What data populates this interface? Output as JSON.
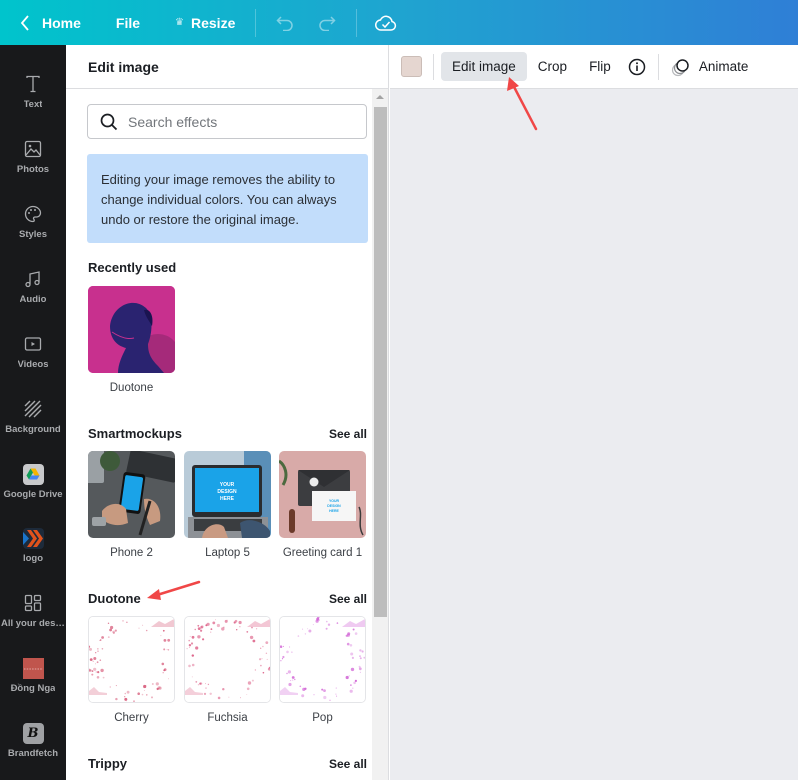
{
  "topbar": {
    "home_label": "Home",
    "file_label": "File",
    "resize_label": "Resize",
    "icons": [
      "chevron-left-icon",
      "crown-icon",
      "undo-icon",
      "redo-icon",
      "cloud-check-icon"
    ]
  },
  "rail": {
    "items": [
      {
        "label": "Text",
        "icon": "text-icon"
      },
      {
        "label": "Photos",
        "icon": "photos-icon"
      },
      {
        "label": "Styles",
        "icon": "palette-icon"
      },
      {
        "label": "Audio",
        "icon": "music-note-icon"
      },
      {
        "label": "Videos",
        "icon": "video-icon"
      },
      {
        "label": "Background",
        "icon": "background-hatch-icon"
      },
      {
        "label": "Google Drive",
        "icon": "google-drive-icon"
      },
      {
        "label": "logo",
        "icon": "logo-chevrons-icon"
      },
      {
        "label": "All your desi...",
        "icon": "grid-icon"
      },
      {
        "label": "Đồng Nga",
        "icon": "folder-thumbnail-icon"
      },
      {
        "label": "Brandfetch",
        "icon": "brandfetch-icon"
      }
    ]
  },
  "panel": {
    "title": "Edit image",
    "search": {
      "placeholder": "Search effects",
      "value": ""
    },
    "notice": "Editing your image removes the ability to change individual colors. You can always undo or restore the original image.",
    "sections": [
      {
        "title": "Recently used",
        "see_all": null,
        "items": [
          {
            "label": "Duotone"
          }
        ]
      },
      {
        "title": "Smartmockups",
        "see_all": "See all",
        "items": [
          {
            "label": "Phone 2"
          },
          {
            "label": "Laptop 5"
          },
          {
            "label": "Greeting card 1"
          }
        ]
      },
      {
        "title": "Duotone",
        "see_all": "See all",
        "items": [
          {
            "label": "Cherry"
          },
          {
            "label": "Fuchsia"
          },
          {
            "label": "Pop"
          }
        ]
      },
      {
        "title": "Trippy",
        "see_all": "See all",
        "items": []
      }
    ],
    "mockup_text": "YOUR DESIGN HERE"
  },
  "context_toolbar": {
    "swatch_color": "#e5d6d0",
    "buttons": [
      "Edit image",
      "Crop",
      "Flip"
    ],
    "active": "Edit image",
    "animate_label": "Animate"
  },
  "colors": {
    "topbar_start": "#00c4cc",
    "topbar_end": "#2f7fd6",
    "rail_bg": "#18191b",
    "notice_bg": "#c2ddfb",
    "canvas_bg": "#ebecf0",
    "annotation_arrow": "#f04747"
  }
}
